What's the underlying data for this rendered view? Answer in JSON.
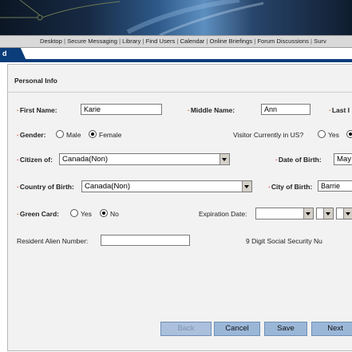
{
  "nav": {
    "links": [
      "Desktop",
      "Secure Messaging",
      "Library",
      "Find Users",
      "Calendar",
      "Online Briefings",
      "Forum Discussions",
      "Surv"
    ]
  },
  "tab": {
    "label": "d"
  },
  "section": {
    "title": "Personal Info"
  },
  "form": {
    "first_name": {
      "label": "First Name:",
      "value": "Karie"
    },
    "middle_name": {
      "label": "Middle Name:",
      "value": "Ann"
    },
    "last_name": {
      "label": "Last I"
    },
    "gender": {
      "label": "Gender:",
      "options": [
        "Male",
        "Female"
      ],
      "selected": "Female"
    },
    "visitor": {
      "label": "Visitor Currently in US?",
      "option_yes": "Yes"
    },
    "citizen_of": {
      "label": "Citizen of:",
      "value": "Canada(Non)"
    },
    "date_of_birth": {
      "label": "Date of Birth:",
      "value": "May"
    },
    "country_of_birth": {
      "label": "Country of Birth:",
      "value": "Canada(Non)"
    },
    "city_of_birth": {
      "label": "City of Birth:",
      "value": "Barrie"
    },
    "green_card": {
      "label": "Green Card:",
      "options": [
        "Yes",
        "No"
      ],
      "selected": "No"
    },
    "expiration_date": {
      "label": "Expiration Date:"
    },
    "resident_alien": {
      "label": "Resident Alien Number:",
      "value": ""
    },
    "ssn": {
      "label": "9 Digit Social Security Nu"
    }
  },
  "buttons": {
    "back": "Back",
    "cancel": "Cancel",
    "save": "Save",
    "next": "Next"
  }
}
